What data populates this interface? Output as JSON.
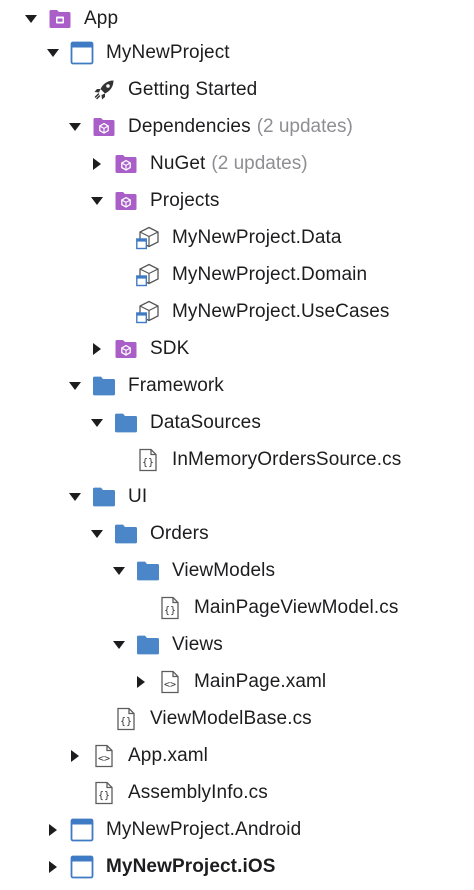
{
  "colors": {
    "solution_purple": "#a95ec8",
    "folder_blue": "#4a86c8",
    "project_blue": "#3f7bc4",
    "text": "#1d1d1f",
    "muted": "#8e8e93"
  },
  "tree": {
    "app": {
      "label": "App",
      "icon": "solution-icon"
    },
    "my_new_project": {
      "label": "MyNewProject",
      "icon": "project-icon"
    },
    "getting_started": {
      "label": "Getting Started",
      "icon": "rocket-icon"
    },
    "dependencies": {
      "label": "Dependencies",
      "note": "(2 updates)",
      "icon": "package-folder-icon"
    },
    "nuget": {
      "label": "NuGet",
      "note": "(2 updates)",
      "icon": "package-folder-icon"
    },
    "projects": {
      "label": "Projects",
      "icon": "package-folder-icon"
    },
    "ref_data": {
      "label": "MyNewProject.Data",
      "icon": "project-reference-icon"
    },
    "ref_domain": {
      "label": "MyNewProject.Domain",
      "icon": "project-reference-icon"
    },
    "ref_usecases": {
      "label": "MyNewProject.UseCases",
      "icon": "project-reference-icon"
    },
    "sdk": {
      "label": "SDK",
      "icon": "package-folder-icon"
    },
    "framework": {
      "label": "Framework",
      "icon": "folder-icon"
    },
    "datasources": {
      "label": "DataSources",
      "icon": "folder-icon"
    },
    "inmemory": {
      "label": "InMemoryOrdersSource.cs",
      "icon": "csharp-file-icon"
    },
    "ui": {
      "label": "UI",
      "icon": "folder-icon"
    },
    "orders": {
      "label": "Orders",
      "icon": "folder-icon"
    },
    "viewmodels": {
      "label": "ViewModels",
      "icon": "folder-icon"
    },
    "mainpage_vm": {
      "label": "MainPageViewModel.cs",
      "icon": "csharp-file-icon"
    },
    "views": {
      "label": "Views",
      "icon": "folder-icon"
    },
    "mainpage_xaml": {
      "label": "MainPage.xaml",
      "icon": "xaml-file-icon"
    },
    "viewmodelbase": {
      "label": "ViewModelBase.cs",
      "icon": "csharp-file-icon"
    },
    "app_xaml": {
      "label": "App.xaml",
      "icon": "xaml-file-icon"
    },
    "assemblyinfo": {
      "label": "AssemblyInfo.cs",
      "icon": "csharp-file-icon"
    },
    "android": {
      "label": "MyNewProject.Android",
      "icon": "project-icon"
    },
    "ios": {
      "label": "MyNewProject.iOS",
      "icon": "project-icon"
    }
  }
}
